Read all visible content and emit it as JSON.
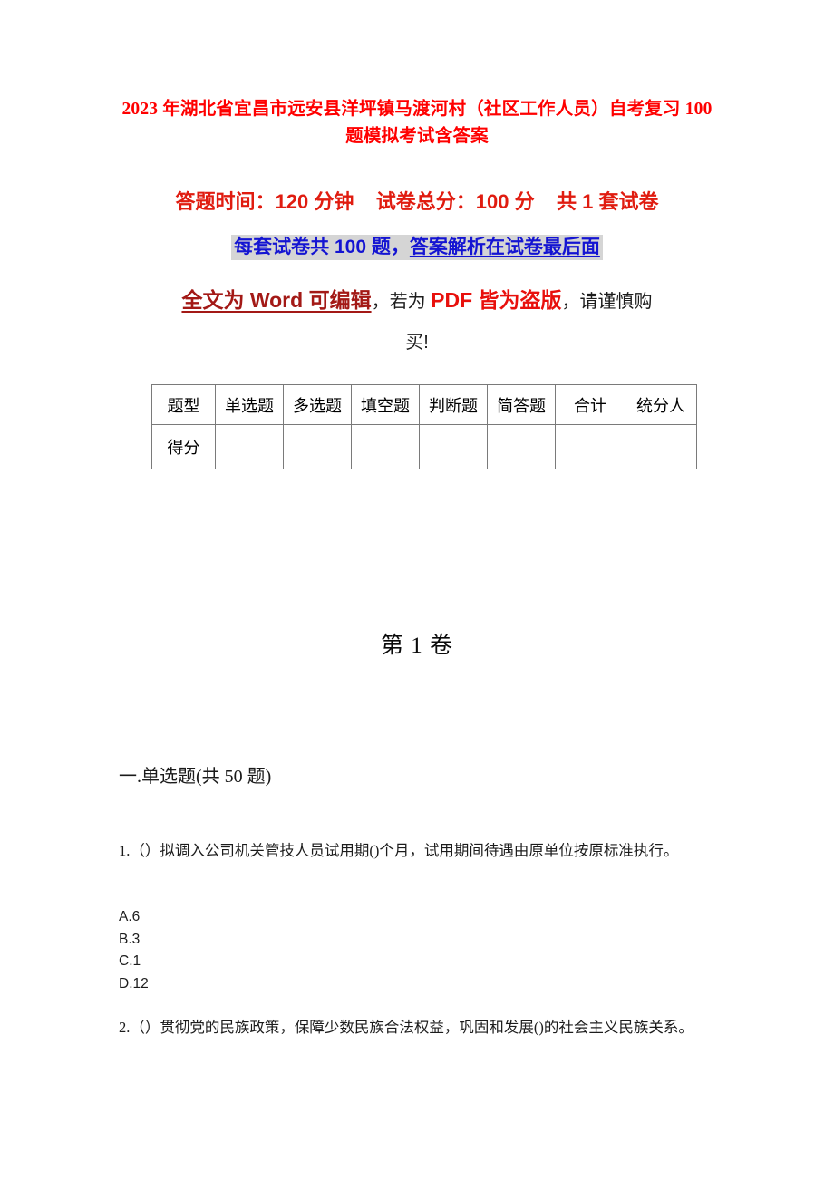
{
  "document": {
    "title": "2023 年湖北省宜昌市远安县洋坪镇马渡河村（社区工作人员）自考复习 100 题模拟考试含答案",
    "colors": {
      "title_red": "#ff0000",
      "meta_red": "#e01c10",
      "highlight_blue": "#1414d2",
      "highlight_bg": "#d5d5d5",
      "dark_red": "#a31916",
      "bright_red": "#e8100c",
      "body_text": "#1c1c1c"
    }
  },
  "meta": {
    "line1": "答题时间：120 分钟    试卷总分：100 分    共 1 套试卷",
    "line2_plain": "每套试卷共 100 题，",
    "line2_underlined": "答案解析在试卷最后面"
  },
  "warning": {
    "part_a": "全文为 Word 可编辑",
    "part_b": "，若为 ",
    "part_c": "PDF 皆为盗版",
    "part_d": "，请谨慎购",
    "tail": "买!"
  },
  "score_table": {
    "headers": [
      "题型",
      "单选题",
      "多选题",
      "填空题",
      "判断题",
      "简答题",
      "合计",
      "统分人"
    ],
    "row_label": "得分",
    "row_values": [
      "",
      "",
      "",
      "",
      "",
      "",
      ""
    ]
  },
  "volume": {
    "heading": "第 1 卷"
  },
  "sections": {
    "single_choice_heading": "一.单选题(共 50 题)"
  },
  "questions": [
    {
      "number": "1.",
      "text": "1.（）拟调入公司机关管技人员试用期()个月，试用期间待遇由原单位按原标准执行。",
      "options": [
        "A.6",
        "B.3",
        "C.1",
        "D.12"
      ]
    },
    {
      "number": "2.",
      "text": "2.（）贯彻党的民族政策，保障少数民族合法权益，巩固和发展()的社会主义民族关系。",
      "options": []
    }
  ]
}
